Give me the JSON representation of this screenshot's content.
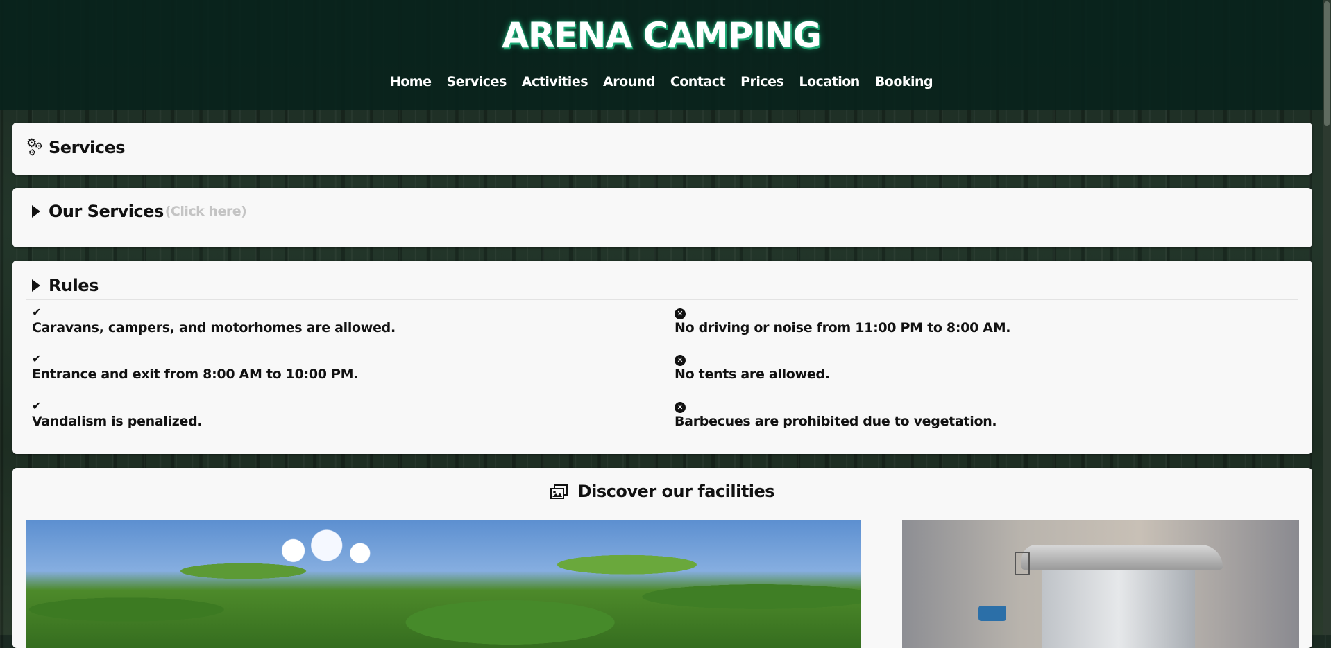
{
  "header": {
    "title": "ARENA CAMPING",
    "nav": [
      "Home",
      "Services",
      "Activities",
      "Around",
      "Contact",
      "Prices",
      "Location",
      "Booking"
    ]
  },
  "services_card": {
    "title": "Services",
    "icon": "gears-icon"
  },
  "our_services": {
    "title": "Our Services",
    "hint": "(Click here)",
    "icon": "caret-right-icon"
  },
  "rules": {
    "title": "Rules",
    "allowed": [
      "Caravans, campers, and motorhomes are allowed.",
      "Entrance and exit from 8:00 AM to 10:00 PM.",
      "Vandalism is penalized."
    ],
    "forbidden": [
      "No driving or noise from 11:00 PM to 8:00 AM.",
      "No tents are allowed.",
      "Barbecues are prohibited due to vegetation."
    ],
    "allowed_icon": "check-icon",
    "forbidden_icon": "x-circle-icon"
  },
  "facilities": {
    "title": "Discover our facilities",
    "icon": "images-icon",
    "photos": [
      "trees-photo",
      "portable-toilet-photo"
    ]
  },
  "colors": {
    "header_bg": "#08221c",
    "title_glow": "#25c28a",
    "card_bg": "#f8f8f8",
    "hint_text": "#c4c4c4"
  }
}
